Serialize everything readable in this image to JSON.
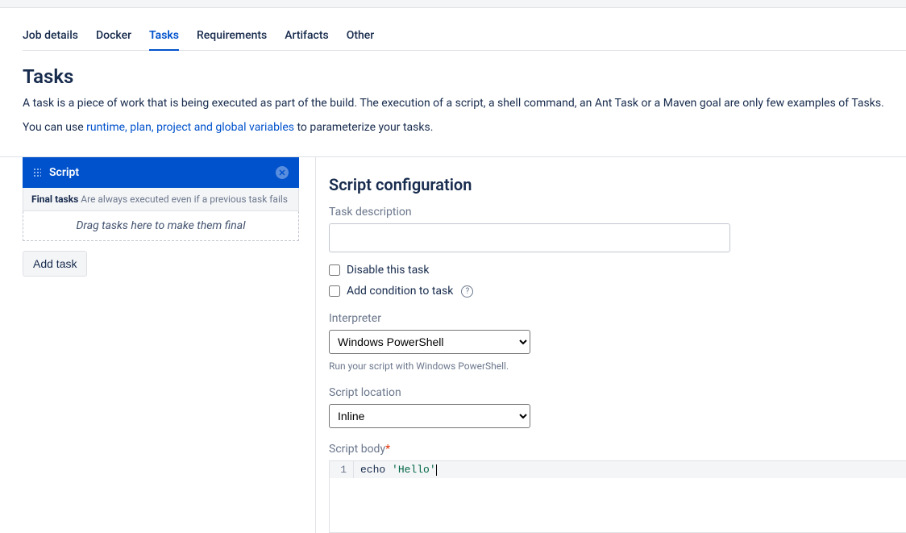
{
  "tabs": {
    "items": [
      {
        "label": "Job details",
        "active": false,
        "name": "tab-job-details"
      },
      {
        "label": "Docker",
        "active": false,
        "name": "tab-docker"
      },
      {
        "label": "Tasks",
        "active": true,
        "name": "tab-tasks"
      },
      {
        "label": "Requirements",
        "active": false,
        "name": "tab-requirements"
      },
      {
        "label": "Artifacts",
        "active": false,
        "name": "tab-artifacts"
      },
      {
        "label": "Other",
        "active": false,
        "name": "tab-other"
      }
    ]
  },
  "page": {
    "title": "Tasks",
    "intro_pre": "A task is a piece of work that is being executed as part of the build. The execution of a script, a shell command, an Ant Task or a Maven goal are only few examples of Tasks.",
    "intro2_pre": "You can use ",
    "intro2_link": "runtime, plan, project and global variables",
    "intro2_post": " to parameterize your tasks."
  },
  "sidebar": {
    "task_label": "Script",
    "final_bold": "Final tasks",
    "final_sub": "Are always executed even if a previous task fails",
    "dropzone": "Drag tasks here to make them final",
    "add_task": "Add task"
  },
  "config": {
    "title": "Script configuration",
    "desc_label": "Task description",
    "desc_value": "",
    "disable_label": "Disable this task",
    "condition_label": "Add condition to task",
    "interp_label": "Interpreter",
    "interp_value": "Windows PowerShell",
    "interp_hint": "Run your script with Windows PowerShell.",
    "loc_label": "Script location",
    "loc_value": "Inline",
    "body_label": "Script body",
    "body_line_no": "1",
    "body_kw": "echo",
    "body_str": "'Hello'"
  }
}
